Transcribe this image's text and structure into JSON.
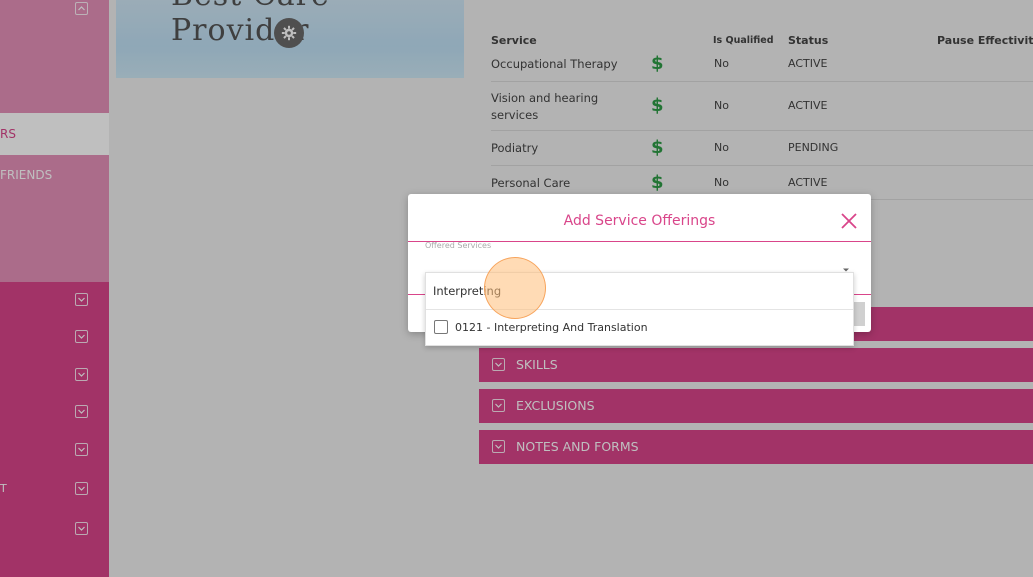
{
  "sidebar": {
    "active_item": "RS",
    "friends_item": "FRIENDS",
    "bottom_item": "T"
  },
  "banner": {
    "title": "Best Care Provider"
  },
  "services_table": {
    "headers": [
      "Service",
      "Is Qualified",
      "Status",
      "Pause Effectivity Da"
    ],
    "rows": [
      {
        "service": "Occupational Therapy",
        "qualified": "No",
        "status": "ACTIVE"
      },
      {
        "service": "Vision and hearing services",
        "qualified": "No",
        "status": "ACTIVE"
      },
      {
        "service": "Podiatry",
        "qualified": "No",
        "status": "PENDING"
      },
      {
        "service": "Personal Care",
        "qualified": "No",
        "status": "ACTIVE"
      }
    ]
  },
  "accordions": [
    "SKILLS",
    "EXCLUSIONS",
    "NOTES AND FORMS"
  ],
  "modal": {
    "title": "Add Service Offerings",
    "field_label": "Offered Services",
    "search_value": "Interpreting",
    "options": [
      "0121 - Interpreting And Translation"
    ]
  },
  "colors": {
    "brand_pink": "#d9458a",
    "sidebar_light": "#e590b9",
    "money_green": "#2e9b46"
  }
}
